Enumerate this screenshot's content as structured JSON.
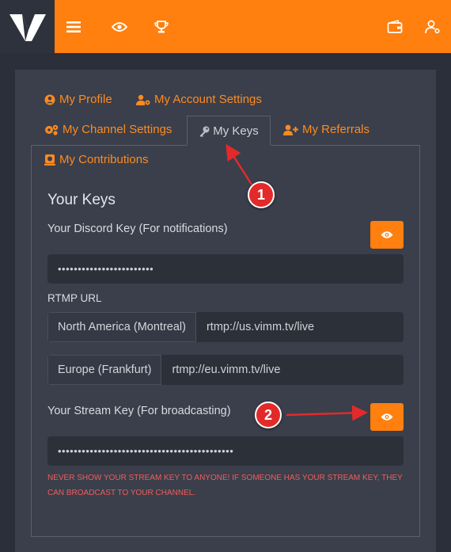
{
  "topbar": {
    "brand_color": "#ff7f0f",
    "icons": [
      "logo",
      "menu-icon",
      "eye-icon",
      "trophy-icon",
      "wallet-icon",
      "user-gear-icon"
    ]
  },
  "tabs": [
    {
      "label": "My Profile",
      "icon": "user-circle-icon"
    },
    {
      "label": "My Account Settings",
      "icon": "user-cog-icon"
    },
    {
      "label": "My Channel Settings",
      "icon": "cogs-icon"
    },
    {
      "label": "My Keys",
      "icon": "key-icon",
      "active": true
    },
    {
      "label": "My Referrals",
      "icon": "user-plus-icon"
    },
    {
      "label": "My Contributions",
      "icon": "money-icon"
    }
  ],
  "keys": {
    "title": "Your Keys",
    "discord_label": "Your Discord Key (For notifications)",
    "discord_value": "••••••••••••••••••••••••",
    "rtmp_label": "RTMP URL",
    "rtmp": [
      {
        "region": "North America (Montreal)",
        "url": "rtmp://us.vimm.tv/live"
      },
      {
        "region": "Europe (Frankfurt)",
        "url": "rtmp://eu.vimm.tv/live"
      }
    ],
    "stream_label": "Your Stream Key (For broadcasting)",
    "stream_value": "••••••••••••••••••••••••••••••••••••••••••••",
    "warning": "NEVER SHOW YOUR STREAM KEY TO ANYONE! IF SOMEONE HAS YOUR STREAM KEY, THEY CAN BROADCAST TO YOUR CHANNEL."
  },
  "annotations": {
    "marker_1": "1",
    "marker_2": "2",
    "color": "#e32a2a"
  }
}
